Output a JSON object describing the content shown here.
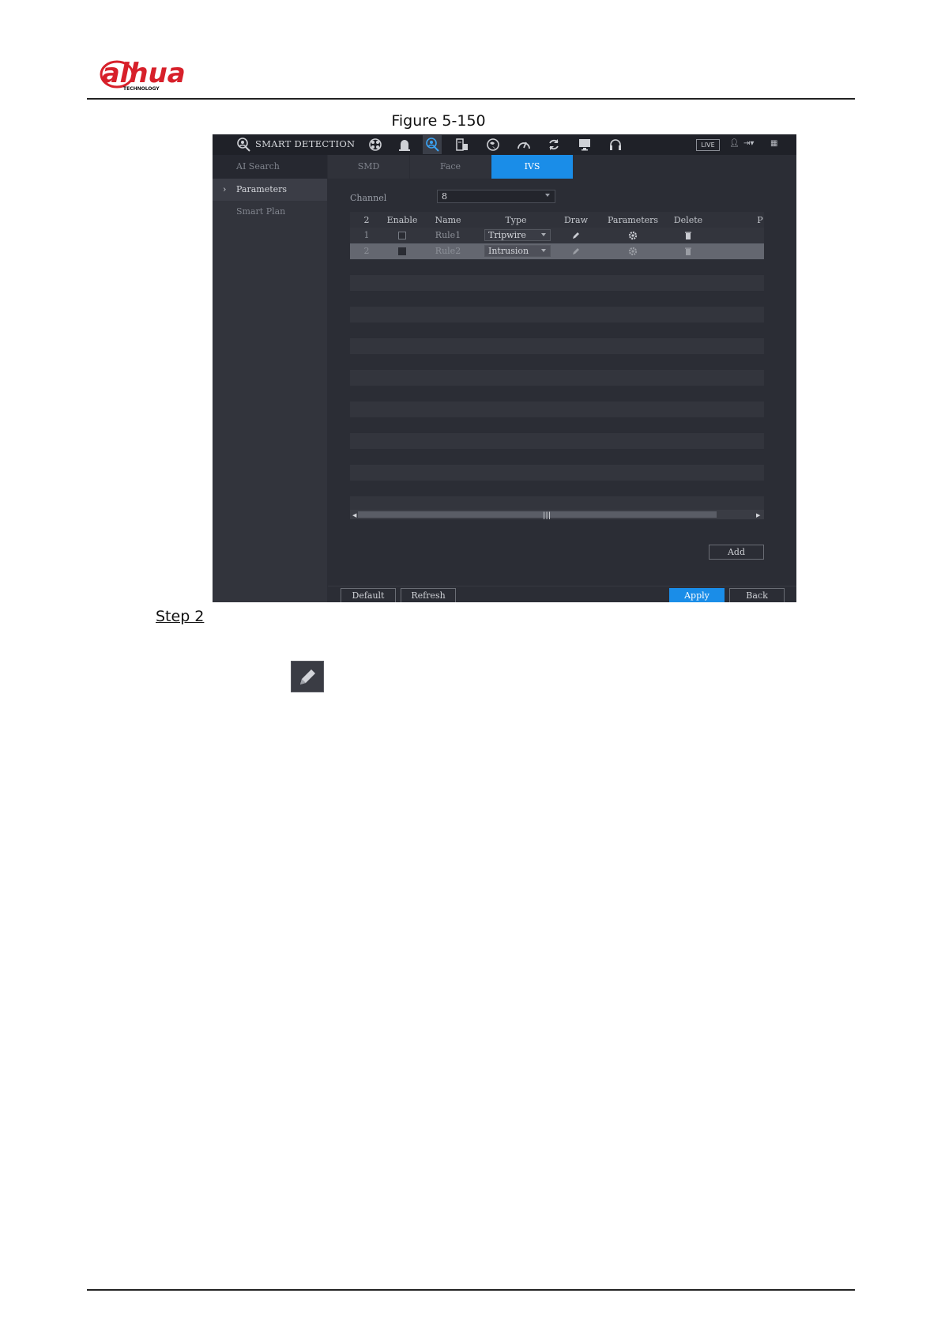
{
  "header": {
    "brand": "alhua",
    "brand_sub": "TECHNOLOGY"
  },
  "figure": {
    "caption": "Figure 5-150"
  },
  "app": {
    "title": "SMART DETECTION",
    "live_label": "LIVE",
    "toolbar_icons": [
      "smart-detection-icon",
      "camera-icon",
      "alarm-icon",
      "ai-search-icon",
      "storage-icon",
      "network-icon",
      "performance-icon",
      "update-icon",
      "display-icon",
      "headset-icon"
    ]
  },
  "tabs": [
    {
      "label": "AI Search"
    },
    {
      "label": "SMD"
    },
    {
      "label": "Face"
    },
    {
      "label": "IVS",
      "active": true
    }
  ],
  "sidebar": {
    "items": [
      {
        "label": "Parameters",
        "active": true
      },
      {
        "label": "Smart Plan"
      }
    ]
  },
  "channel": {
    "label": "Channel",
    "value": "8"
  },
  "table": {
    "columns": [
      "2",
      "Enable",
      "Name",
      "Type",
      "Draw",
      "Parameters",
      "Delete",
      "P"
    ],
    "rows": [
      {
        "index": "1",
        "enabled": false,
        "name": "Rule1",
        "type": "Tripwire"
      },
      {
        "index": "2",
        "enabled": true,
        "name": "Rule2",
        "type": "Intrusion",
        "selected": true
      }
    ]
  },
  "buttons": {
    "add": "Add",
    "default": "Default",
    "refresh": "Refresh",
    "apply": "Apply",
    "back": "Back"
  },
  "step": {
    "label": "Step 2"
  },
  "colors": {
    "accent": "#1a8de8",
    "brand_red": "#d7202a"
  }
}
